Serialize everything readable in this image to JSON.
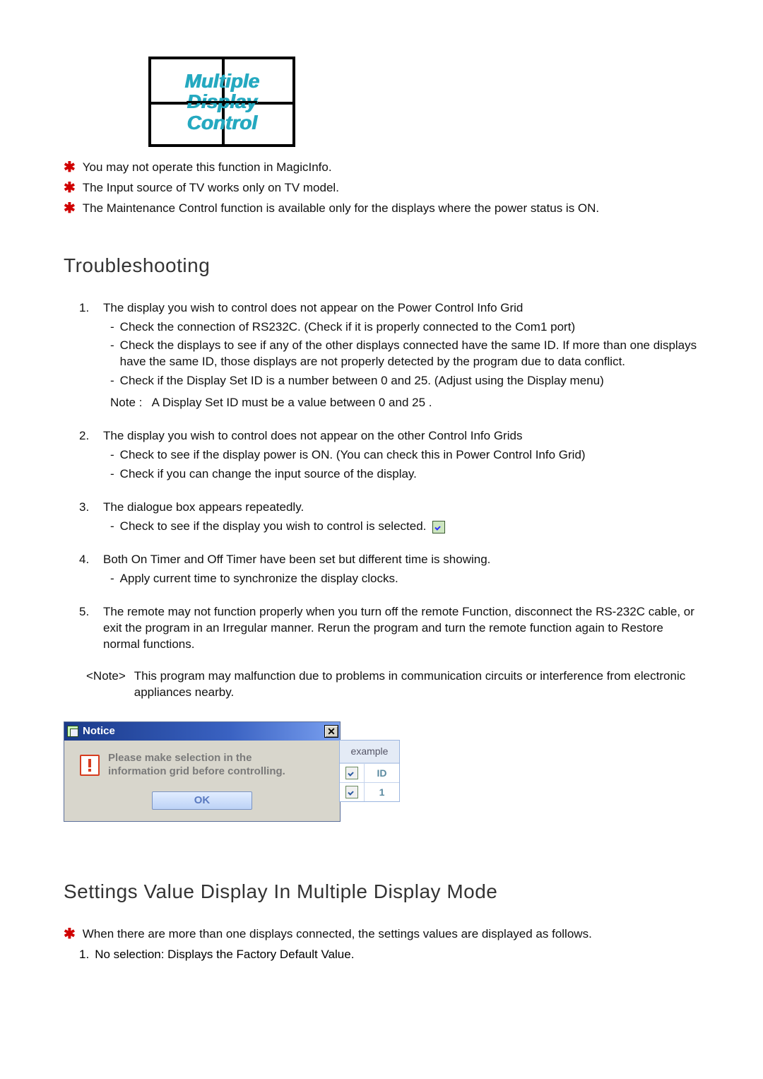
{
  "logo": {
    "line1": "Multiple",
    "line2": "Display",
    "line3": "Control"
  },
  "top_notes": [
    "You may not operate this function in MagicInfo.",
    "The Input source of TV works only on TV model.",
    "The Maintenance Control function is available only for the displays where the power status is ON."
  ],
  "heading_troubleshooting": "Troubleshooting",
  "ts": [
    {
      "num": "1.",
      "title": "The display you wish to control does not appear on the Power Control Info Grid",
      "subs": [
        "Check the connection of RS232C. (Check if it is properly connected to the Com1 port)",
        "Check the displays to see if any of the other displays connected have the same ID. If more than one displays have the same ID, those displays are not properly detected by the program due to data conflict.",
        "Check if the Display Set ID is a number between 0 and 25. (Adjust using the Display menu)"
      ],
      "note_label": "Note :",
      "note_text": "A Display Set ID must be a value between 0 and 25 ."
    },
    {
      "num": "2.",
      "title": "The display you wish to control does not appear on the other Control Info Grids",
      "subs": [
        "Check to see if the display power is ON. (You can check this in Power Control Info Grid)",
        "Check if you can change the input source of the display."
      ]
    },
    {
      "num": "3.",
      "title": "The dialogue box appears repeatedly.",
      "subs_with_icon": "Check to see if the display you wish to control is selected."
    },
    {
      "num": "4.",
      "title": "Both On Timer and Off Timer have been set but different time is showing.",
      "subs": [
        "Apply current time to synchronize the display clocks."
      ]
    },
    {
      "num": "5.",
      "title": "The remote may not function properly when you turn off the remote Function, disconnect the RS-232C cable, or exit the program in an Irregular manner. Rerun the program and turn the remote function again to Restore normal functions."
    }
  ],
  "global_note": {
    "label": "<Note>",
    "text": "This program may malfunction due to problems in communication circuits or interference from electronic appliances nearby."
  },
  "notice_dialog": {
    "title": "Notice",
    "message_line1": "Please make selection in the",
    "message_line2": "information grid before controlling.",
    "ok": "OK"
  },
  "example_panel": {
    "header": "example",
    "row_header_id": "ID",
    "row_value_id": "1"
  },
  "heading_settings": "Settings Value Display In Multiple Display Mode",
  "settings_note": "When there are more than one displays connected, the settings values are displayed as follows.",
  "settings_list": [
    {
      "num": "1.",
      "text": "No selection: Displays the Factory Default Value."
    }
  ]
}
